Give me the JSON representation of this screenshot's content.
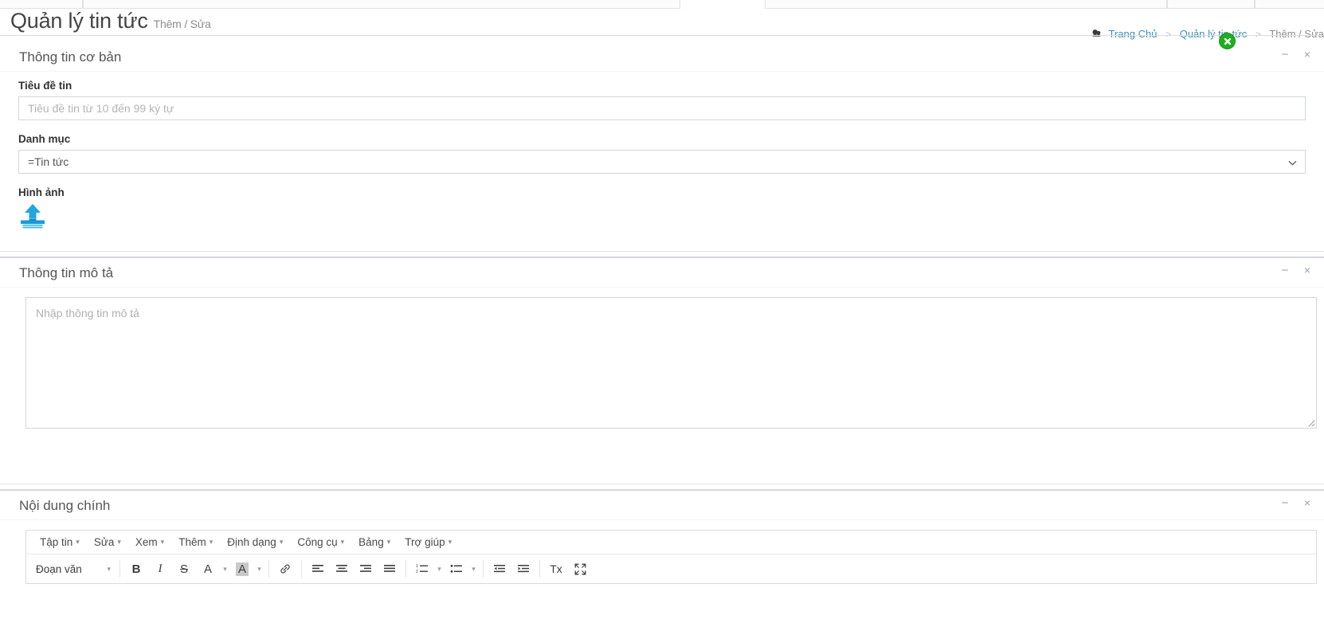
{
  "page": {
    "title": "Quản lý tin tức",
    "subtitle": "Thêm / Sửa"
  },
  "breadcrumb": {
    "home_icon": "dashboard-icon",
    "items": [
      {
        "label": "Trang Chủ",
        "link": true
      },
      {
        "label": "Quản lý tin tức",
        "link": true
      },
      {
        "label": "Thêm / Sửa",
        "link": false
      }
    ],
    "separator": ">"
  },
  "close_badge": {
    "icon": "close-icon",
    "color": "#1fae1f"
  },
  "boxes": [
    {
      "title": "Thông tin cơ bản",
      "tools": {
        "collapse": "−",
        "remove": "×"
      },
      "fields": {
        "title_label": "Tiêu đề tin",
        "title_placeholder": "Tiêu đề tin từ 10 đến 99 ký tự",
        "title_value": "",
        "category_label": "Danh mục",
        "category_value": "=Tin tức",
        "category_options": [
          "=Tin tức"
        ],
        "image_label": "Hình ảnh",
        "image_upload_icon": "upload-icon"
      }
    },
    {
      "title": "Thông tin mô tả",
      "tools": {
        "collapse": "−",
        "remove": "×"
      },
      "description_placeholder": "Nhập thông tin mô tả",
      "description_value": ""
    },
    {
      "title": "Nội dung chính",
      "tools": {
        "collapse": "−",
        "remove": "×"
      }
    }
  ],
  "editor": {
    "menubar": [
      {
        "label": "Tập tin"
      },
      {
        "label": "Sửa"
      },
      {
        "label": "Xem"
      },
      {
        "label": "Thêm"
      },
      {
        "label": "Định dạng"
      },
      {
        "label": "Công cụ"
      },
      {
        "label": "Bảng"
      },
      {
        "label": "Trợ giúp"
      }
    ],
    "caret": "▾",
    "format_select": "Đoạn văn",
    "buttons": [
      {
        "name": "bold",
        "glyph": "B"
      },
      {
        "name": "italic",
        "glyph": "I"
      },
      {
        "name": "strikethrough",
        "glyph": "S"
      },
      {
        "name": "text-color",
        "glyph": "A"
      },
      {
        "name": "background-color",
        "glyph": "A"
      },
      {
        "name": "link",
        "glyph": "link"
      },
      {
        "name": "align-left",
        "glyph": "align-left"
      },
      {
        "name": "align-center",
        "glyph": "align-center"
      },
      {
        "name": "align-right",
        "glyph": "align-right"
      },
      {
        "name": "align-justify",
        "glyph": "align-justify"
      },
      {
        "name": "numbered-list",
        "glyph": "ol"
      },
      {
        "name": "bulleted-list",
        "glyph": "ul"
      },
      {
        "name": "outdent",
        "glyph": "outdent"
      },
      {
        "name": "indent",
        "glyph": "indent"
      },
      {
        "name": "clear-formatting",
        "glyph": "Tx"
      },
      {
        "name": "fullscreen",
        "glyph": "fullscreen"
      }
    ]
  }
}
